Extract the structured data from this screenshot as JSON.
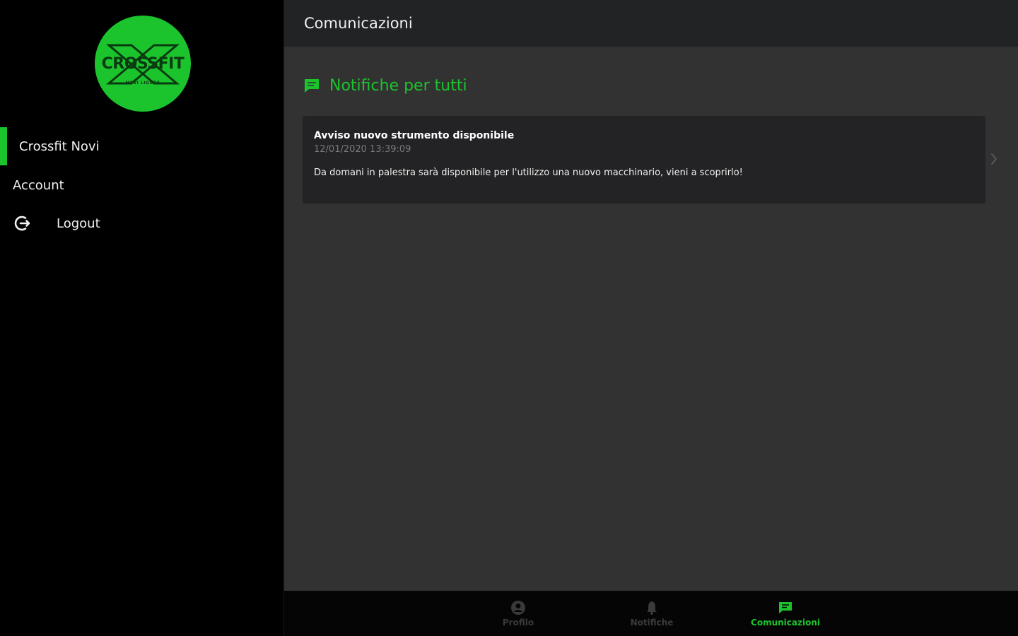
{
  "colors": {
    "accent": "#1bc42c",
    "sidebar_bg": "#000000",
    "main_bg": "#323232",
    "topbar_bg": "#222325",
    "card_bg": "#232325"
  },
  "logo": {
    "text": "CROSSFIT",
    "subtext": "NOVI LIGURE"
  },
  "sidebar": {
    "items": [
      {
        "label": "Crossfit Novi",
        "active": true
      },
      {
        "label": "Account"
      },
      {
        "label": "Logout",
        "icon": "logout-icon"
      }
    ]
  },
  "topbar": {
    "title": "Comunicazioni"
  },
  "section": {
    "title": "Notifiche per tutti",
    "icon": "chat-icon"
  },
  "card": {
    "title": "Avviso nuovo strumento disponibile",
    "date": "12/01/2020 13:39:09",
    "body": "Da domani in palestra sarà disponibile per l'utilizzo una nuovo macchinario, vieni a scoprirlo!"
  },
  "bottom_nav": {
    "tabs": [
      {
        "label": "Profilo",
        "icon": "user-icon"
      },
      {
        "label": "Notifiche",
        "icon": "bell-icon"
      },
      {
        "label": "Comunicazioni",
        "icon": "chat-icon",
        "active": true
      }
    ]
  }
}
